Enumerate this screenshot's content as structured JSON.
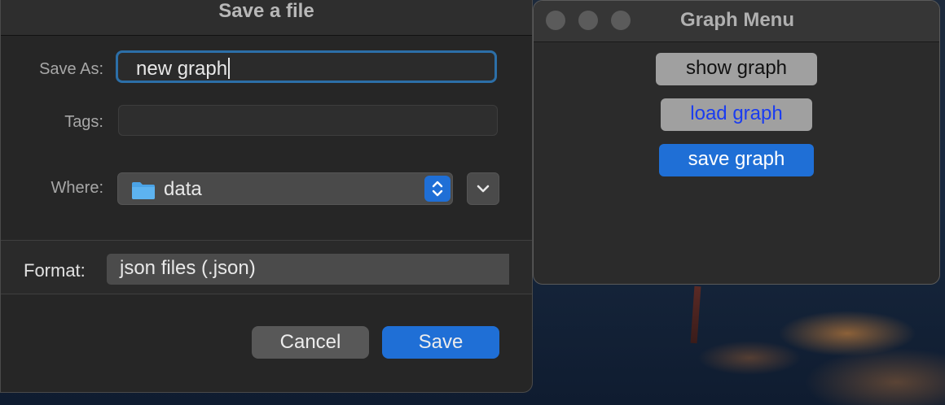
{
  "save_dialog": {
    "title": "Save a file",
    "save_as_label": "Save As:",
    "save_as_value": "new graph",
    "tags_label": "Tags:",
    "tags_value": "",
    "where_label": "Where:",
    "where_value": "data",
    "format_label": "Format:",
    "format_value": "json files (.json)",
    "cancel_label": "Cancel",
    "save_label": "Save",
    "accent_color": "#1f6fd6"
  },
  "graph_menu": {
    "title": "Graph Menu",
    "buttons": [
      {
        "label": "show graph"
      },
      {
        "label": "load graph"
      },
      {
        "label": "save graph"
      }
    ]
  }
}
